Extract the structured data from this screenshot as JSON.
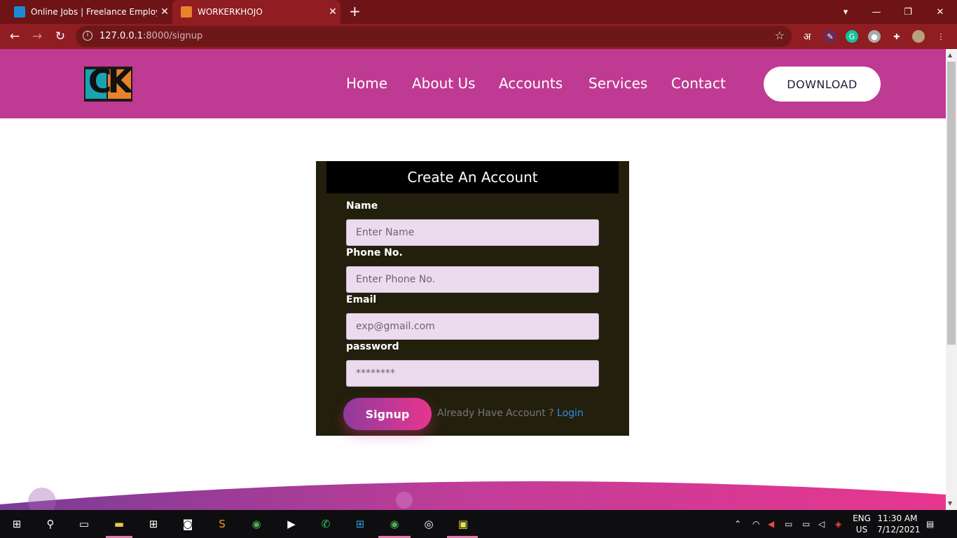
{
  "browser": {
    "tabs": [
      {
        "title": "Online Jobs | Freelance Employm",
        "favicon_color": "#1b8ad6"
      },
      {
        "title": "WORKERKHOJO",
        "favicon_color": "#e8832b"
      }
    ],
    "url_host": "127.0.0.1",
    "url_rest": ":8000/signup",
    "new_tab_icon": "plus-icon"
  },
  "site": {
    "logo_text": "CK",
    "nav": [
      "Home",
      "About Us",
      "Accounts",
      "Services",
      "Contact"
    ],
    "download_label": "DOWNLOAD",
    "brand_color": "#bf3a92"
  },
  "form": {
    "title": "Create An Account",
    "fields": [
      {
        "label": "Name",
        "placeholder": "Enter Name",
        "type": "text"
      },
      {
        "label": "Phone No.",
        "placeholder": "Enter Phone No.",
        "type": "text"
      },
      {
        "label": "Email",
        "placeholder": "exp@gmail.com",
        "type": "email"
      },
      {
        "label": "password",
        "placeholder": "********",
        "type": "password"
      }
    ],
    "submit_label": "Signup",
    "already_text": "Already Have Account ?",
    "login_label": "Login"
  },
  "taskbar": {
    "language": "ENG",
    "region": "US",
    "time": "11:30 AM",
    "date": "7/12/2021"
  }
}
